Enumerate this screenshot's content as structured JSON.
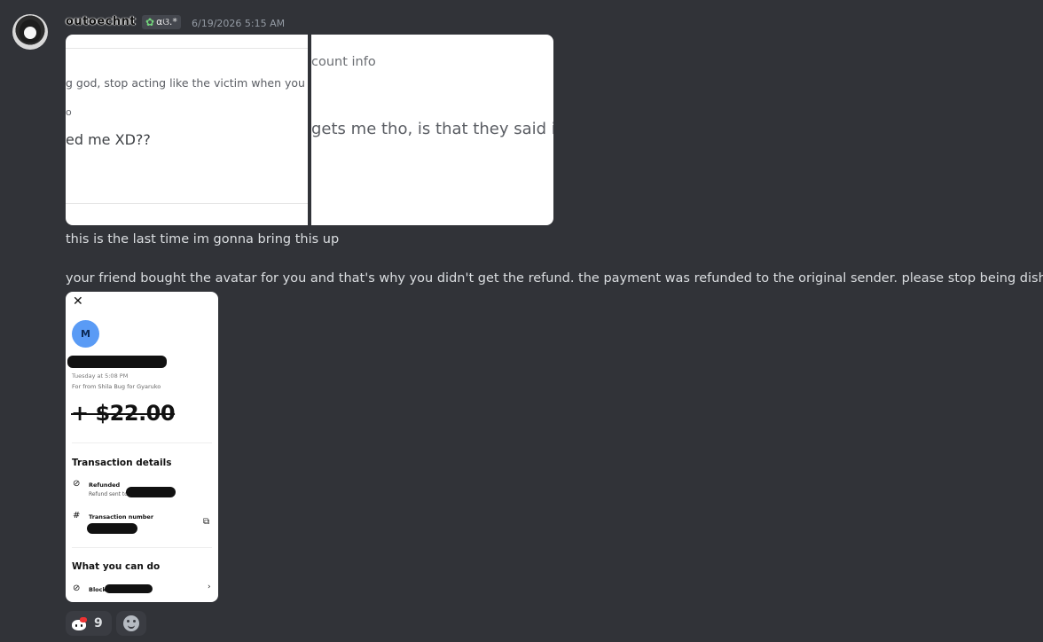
{
  "message": {
    "author": "outoechnt",
    "tag": "αଓ.*",
    "tag_icon": "clover-icon",
    "timestamp": "6/19/2026 5:15 AM",
    "text_line_1": "this is the last time im gonna bring this up",
    "text_line_2": "your friend bought the avatar for you and that's why you didn't get the refund. the payment was refunded to the original sender. please stop being dishonest"
  },
  "attachment_1": {
    "line_1": "g god, stop acting like the victim when you h",
    "line_2": "o",
    "line_3": "ed me XD??"
  },
  "attachment_2": {
    "line_1": "count info",
    "line_2": "gets me tho, is that they said in"
  },
  "receipt": {
    "close_glyph": "✕",
    "avatar_letter": "M",
    "date": "Tuesday at 5:08 PM",
    "from_note": "For from Shila Bug for Gyaruko",
    "amount": "+ $22.00",
    "section_1_title": "Transaction details",
    "refunded_label": "Refunded",
    "refund_sent_label": "Refund sent to",
    "transaction_number_label": "Transaction number",
    "section_2_title": "What you can do",
    "block_label": "Block"
  },
  "reactions": [
    {
      "emoji": "hello-kitty-emoji",
      "count": "9"
    },
    {
      "emoji": "add-reaction-icon"
    }
  ],
  "colors": {
    "background": "#313338",
    "text": "#dbdee1",
    "timestamp": "#949ba4",
    "receipt_avatar": "#5a9bf5"
  }
}
